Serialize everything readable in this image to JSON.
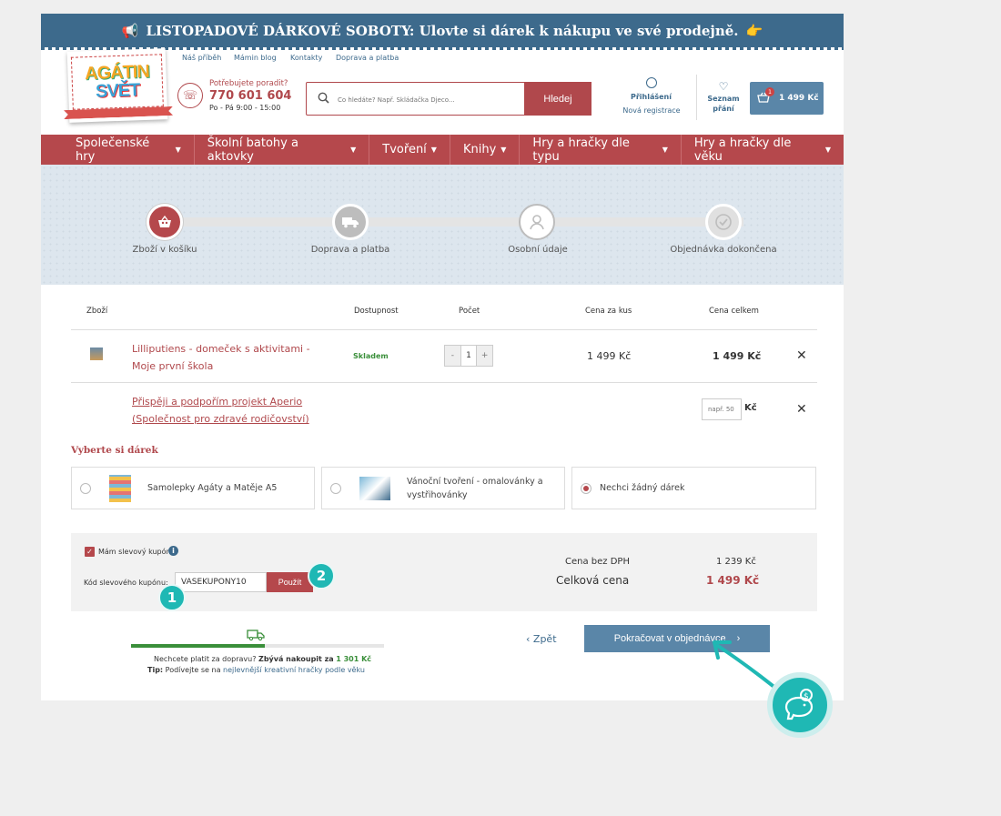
{
  "banner": {
    "icon": "megaphone-icon",
    "text": "LISTOPADOVÉ DÁRKOVÉ SOBOTY: Ulovte si dárek k nákupu ve své prodejně.",
    "trailing_icon": "pointing-hand-icon"
  },
  "logo": {
    "line1": "AGÁTIN",
    "line2": "SVĚT"
  },
  "top_links": [
    "Náš příběh",
    "Mámin blog",
    "Kontakty",
    "Doprava a platba"
  ],
  "help": {
    "label": "Potřebujete poradit?",
    "phone": "770 601 604",
    "hours": "Po - Pá 9:00 - 15:00"
  },
  "search": {
    "placeholder": "Co hledáte? Např. Skládačka Djeco...",
    "button": "Hledej"
  },
  "account": {
    "login": "Přihlášení",
    "register": "Nová registrace"
  },
  "wishlist": {
    "label": "Seznam přání"
  },
  "cart": {
    "count": "1",
    "total": "1 499 Kč"
  },
  "nav": [
    "Společenské hry",
    "Školní batohy a aktovky",
    "Tvoření",
    "Knihy",
    "Hry a hračky dle typu",
    "Hry a hračky dle věku"
  ],
  "steps": [
    "Zboží v košíku",
    "Doprava a platba",
    "Osobní údaje",
    "Objednávka dokončena"
  ],
  "cart_table": {
    "headers": {
      "product": "Zboží",
      "availability": "Dostupnost",
      "quantity": "Počet",
      "unit_price": "Cena za kus",
      "total": "Cena celkem"
    },
    "item": {
      "name": "Lilliputiens - domeček s aktivitami - Moje první škola",
      "availability": "Skladem",
      "qty_minus": "-",
      "qty": "1",
      "qty_plus": "+",
      "unit_price": "1 499 Kč",
      "total": "1 499 Kč"
    },
    "donation": {
      "text": "Přispěji a podpořím projekt Aperio (Společnost pro zdravé rodičovství)",
      "placeholder": "např. 50",
      "currency": "Kč"
    },
    "remove_symbol": "✕"
  },
  "gift": {
    "title": "Vyberte si dárek",
    "options": [
      {
        "label": "Samolepky Agáty a Matěje A5",
        "selected": false
      },
      {
        "label": "Vánoční tvoření - omalovánky a vystřihovánky",
        "selected": false
      },
      {
        "label": "Nechci žádný dárek",
        "selected": true
      }
    ]
  },
  "coupon": {
    "checkbox_label": "Mám slevový kupón",
    "code_label": "Kód slevového kupónu:",
    "code_value": "VASEKUPONY10",
    "apply": "Použít",
    "info": "i"
  },
  "markers": {
    "one": "1",
    "two": "2"
  },
  "summary": {
    "without_vat_label": "Cena bez DPH",
    "without_vat": "1 239 Kč",
    "total_label": "Celková cena",
    "total": "1 499 Kč"
  },
  "shipping": {
    "progress": 0.53,
    "text_prefix": "Nechcete platit za dopravu?",
    "text_bold": "Zbývá nakoupit za",
    "text_amount": "1 301 Kč",
    "tip_label": "Tip:",
    "tip_text": "Podívejte se na",
    "tip_link": "nejlevnější kreativní hračky podle věku"
  },
  "actions": {
    "back": "Zpět",
    "continue": "Pokračovat v objednávce"
  },
  "colors": {
    "brand_red": "#b5484c",
    "brand_blue": "#3d6a8c",
    "accent_teal": "#1fb8b4",
    "success_green": "#3a8f3a"
  }
}
